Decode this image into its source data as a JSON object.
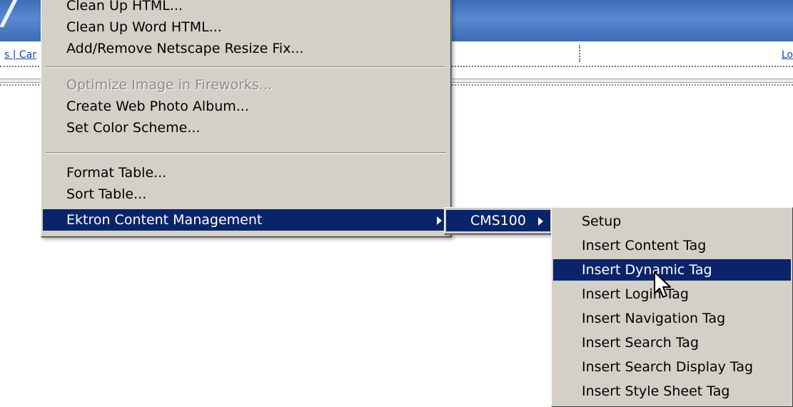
{
  "background": {
    "banner_logo": "/",
    "link_left": "s | Car",
    "link_right": "Lo"
  },
  "main_menu": {
    "items": [
      {
        "label": "Clean Up HTML...",
        "state": "normal"
      },
      {
        "label": "Clean Up Word HTML...",
        "state": "normal"
      },
      {
        "label": "Add/Remove Netscape Resize Fix...",
        "state": "normal"
      },
      {
        "label": "Optimize Image in Fireworks...",
        "state": "disabled"
      },
      {
        "label": "Create Web Photo Album...",
        "state": "normal"
      },
      {
        "label": "Set Color Scheme...",
        "state": "normal"
      },
      {
        "label": "Format Table...",
        "state": "normal"
      },
      {
        "label": "Sort Table...",
        "state": "normal"
      },
      {
        "label": "Ektron Content Management",
        "state": "highlighted"
      }
    ]
  },
  "submenu1": {
    "items": [
      {
        "label": "CMS100",
        "state": "highlighted"
      }
    ]
  },
  "submenu2": {
    "items": [
      {
        "label": "Setup"
      },
      {
        "label": "Insert Content Tag"
      },
      {
        "label": "Insert Dynamic Tag",
        "state": "highlighted"
      },
      {
        "label": "Insert Login Tag"
      },
      {
        "label": "Insert Navigation Tag"
      },
      {
        "label": "Insert Search Tag"
      },
      {
        "label": "Insert Search Display Tag"
      },
      {
        "label": "Insert Style Sheet Tag"
      }
    ]
  },
  "colors": {
    "menu_bg": "#d4d0c8",
    "highlight": "#0a246a",
    "banner": "#4a7cc4",
    "link": "#1a3fb0"
  }
}
